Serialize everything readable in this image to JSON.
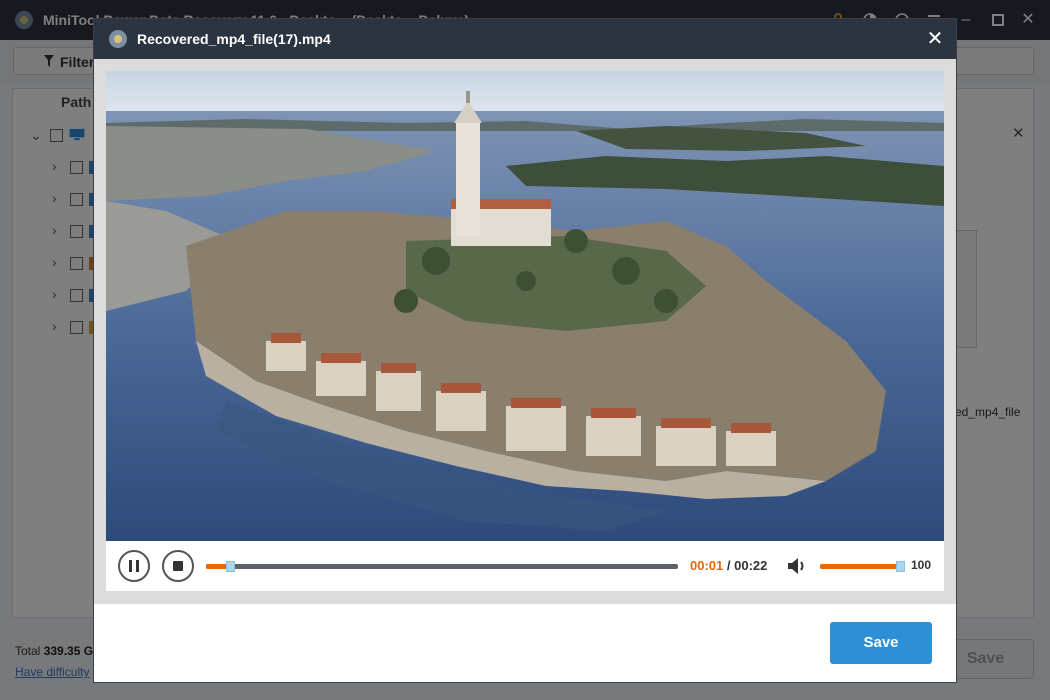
{
  "app": {
    "title": "MiniTool Power Data Recovery 11.6 - Deskto... (Deskto... Deluxe)",
    "filter_label": "Filter",
    "path_header": "Path",
    "right_panel": {
      "filename_fragment": "ed_mp4_file"
    },
    "footer": {
      "total_label": "Total",
      "total_value": "339.35 G",
      "help_link": "Have difficulty",
      "save_label": "Save"
    }
  },
  "preview": {
    "title": "Recovered_mp4_file(17).mp4",
    "current_time": "00:01",
    "separator": "/",
    "total_time": "00:22",
    "progress": 0.05,
    "volume": 100,
    "volume_label": "100",
    "save_label": "Save"
  },
  "colors": {
    "header_bg": "#2c3440",
    "accent_orange": "#e8670c",
    "save_blue": "#2e8fd6"
  },
  "icons": {
    "pause": "pause-icon",
    "stop": "stop-icon",
    "volume": "speaker-icon",
    "close": "close-icon"
  }
}
